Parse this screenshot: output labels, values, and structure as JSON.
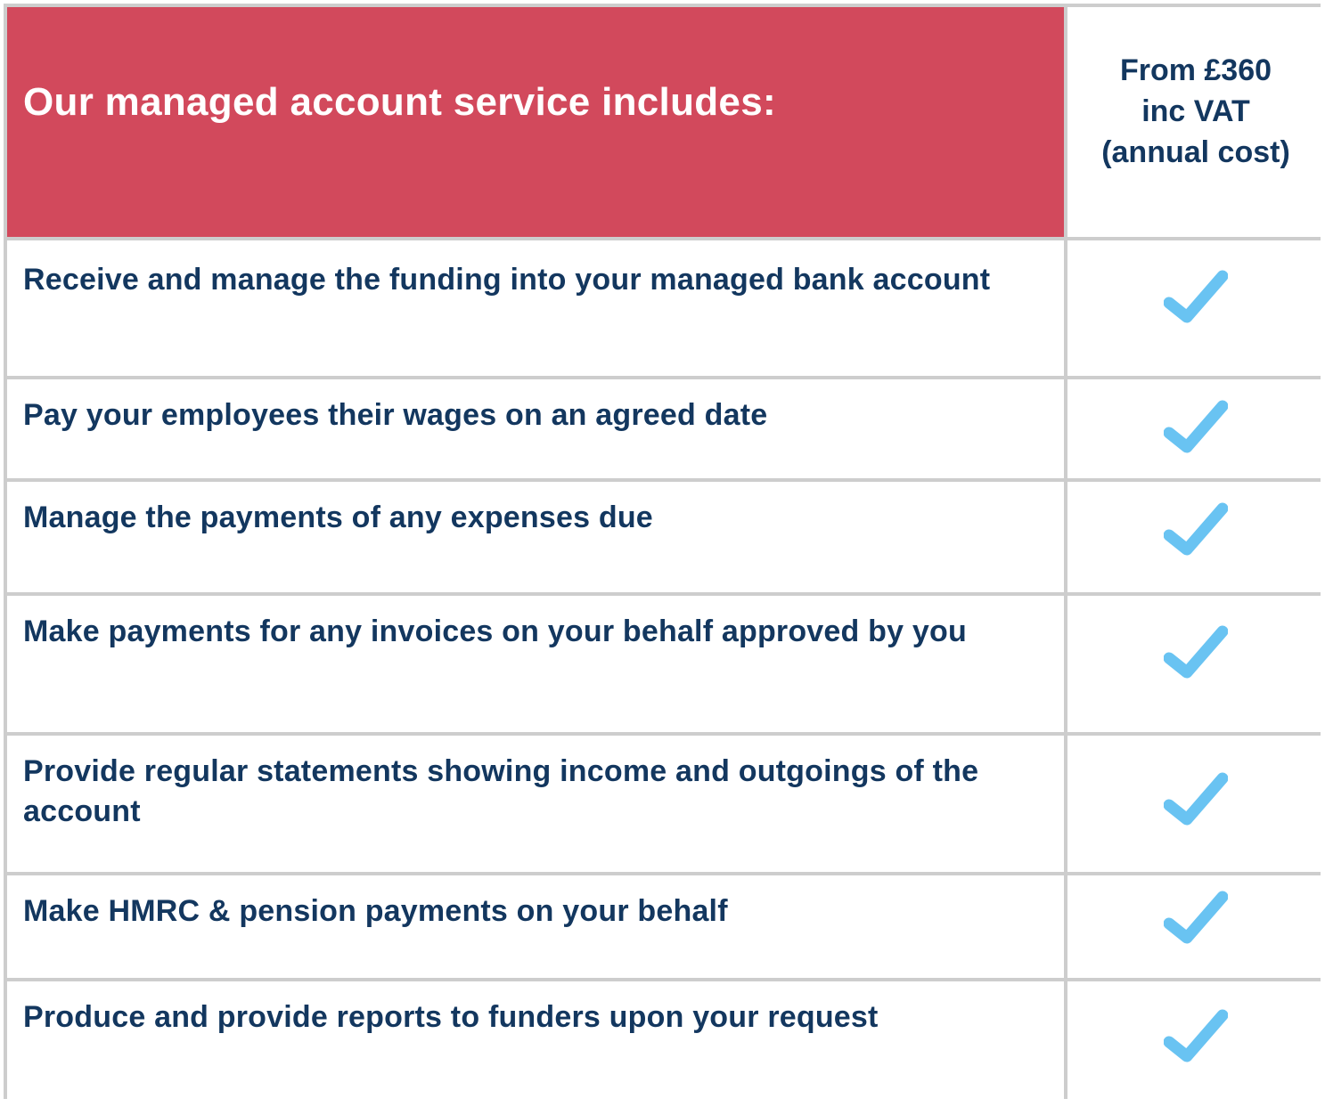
{
  "header": {
    "title": "Our managed account service includes:",
    "price_lines": [
      "From £360",
      "inc VAT",
      "(annual cost)"
    ]
  },
  "colors": {
    "header_bg": "#d2495c",
    "text": "#13375f",
    "tick": "#69c3f2",
    "grid": "#cdcdcd"
  },
  "rows": [
    {
      "label": "Receive and manage the funding into your managed bank account",
      "included": true,
      "icon": "check-icon"
    },
    {
      "label": "Pay your employees their wages on an agreed date",
      "included": true,
      "icon": "check-icon"
    },
    {
      "label": "Manage the payments of any expenses due",
      "included": true,
      "icon": "check-icon"
    },
    {
      "label": "Make payments for any invoices on your behalf approved by you",
      "included": true,
      "icon": "check-icon"
    },
    {
      "label": "Provide regular statements showing income and outgoings of the account",
      "included": true,
      "icon": "check-icon"
    },
    {
      "label": "Make HMRC & pension payments on your behalf",
      "included": true,
      "icon": "check-icon"
    },
    {
      "label": "Produce and provide reports to funders upon your request",
      "included": true,
      "icon": "check-icon"
    }
  ]
}
